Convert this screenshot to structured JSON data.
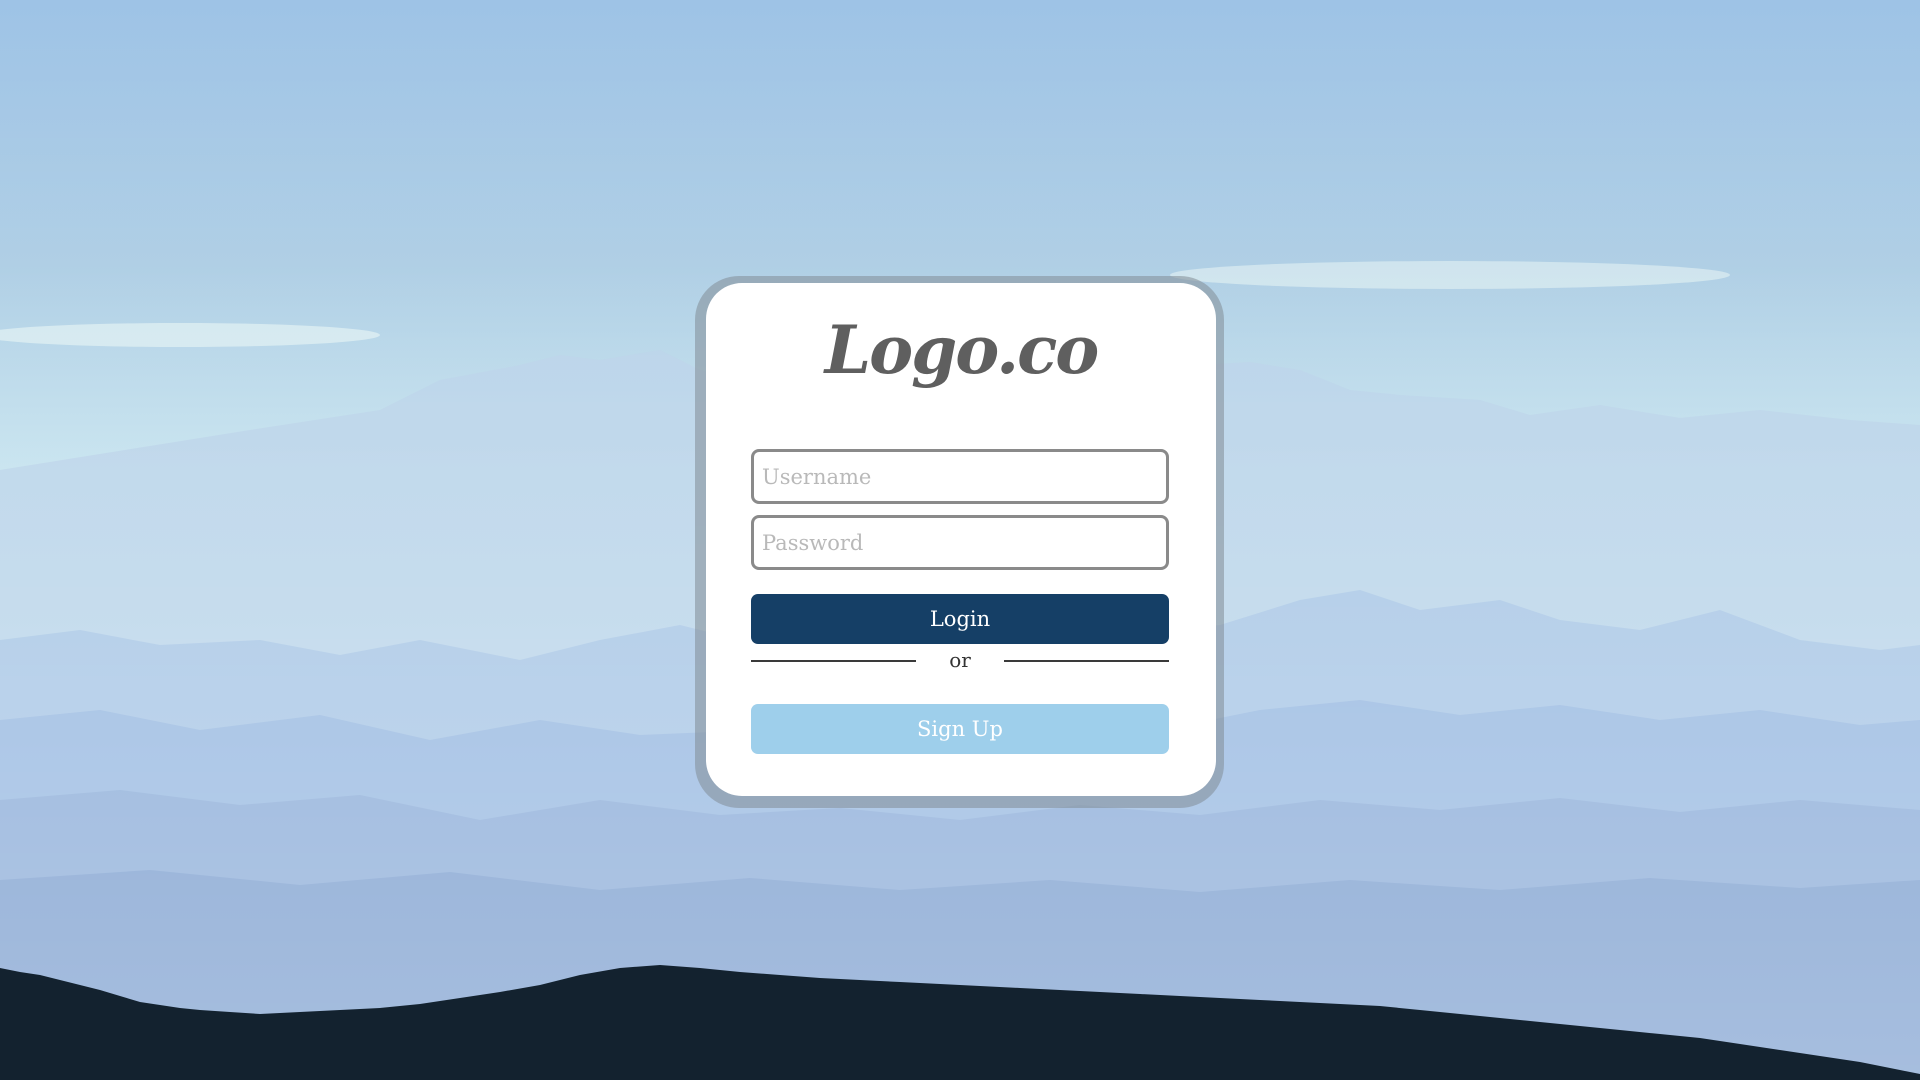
{
  "brand": {
    "logo_text": "Logo.co"
  },
  "login_form": {
    "username_placeholder": "Username",
    "password_placeholder": "Password",
    "login_label": "Login",
    "divider_text": "or",
    "signup_label": "Sign Up"
  },
  "colors": {
    "login_button": "#153f66",
    "signup_button": "#9ecfeb",
    "logo": "#5f5f5f",
    "field_border": "#8a8a8a"
  }
}
